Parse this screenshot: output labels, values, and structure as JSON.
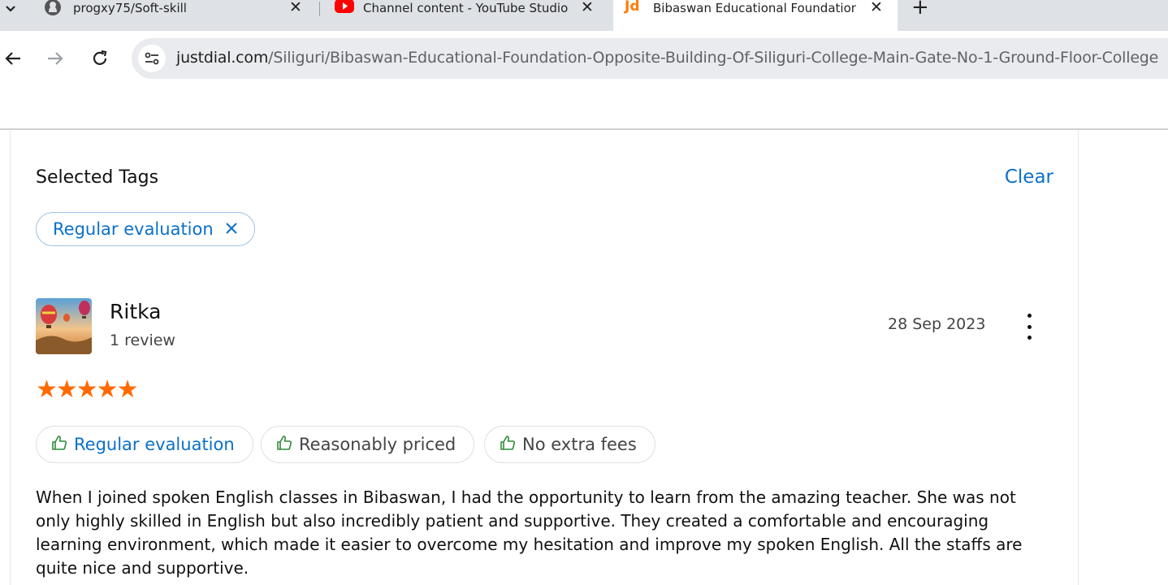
{
  "browser": {
    "tabs": [
      {
        "title": "progxy75/Soft-skill",
        "icon": "github-icon",
        "active": false
      },
      {
        "title": "Channel content - YouTube Studio",
        "icon": "youtube-icon",
        "active": false
      },
      {
        "title": "Bibaswan Educational Foundation",
        "icon": "justdial-icon",
        "active": true
      }
    ],
    "favicon_text": "Jd",
    "url_host": "justdial.com",
    "url_path": "/Siliguri/Bibaswan-Educational-Foundation-Opposite-Building-Of-Siliguri-College-Main-Gate-No-1-Ground-Floor-College"
  },
  "filters": {
    "title": "Selected Tags",
    "clear_label": "Clear",
    "selected": [
      "Regular evaluation"
    ]
  },
  "review": {
    "name": "Ritka",
    "review_count": "1 review",
    "date": "28 Sep 2023",
    "rating": 5,
    "stars": "★★★★★",
    "tags": [
      "Regular evaluation",
      "Reasonably priced",
      "No extra fees"
    ],
    "text": "When I joined spoken English classes in Bibaswan, I had the opportunity to learn from the amazing teacher. She was not only highly skilled in English but also incredibly patient and supportive. They created a comfortable and encouraging learning environment, which made it easier to overcome my hesitation and improve my spoken English. All the staffs are quite nice and supportive."
  },
  "colors": {
    "accent": "#0b70c9",
    "star": "#ff6a00",
    "thumb": "#2e8b3a"
  }
}
